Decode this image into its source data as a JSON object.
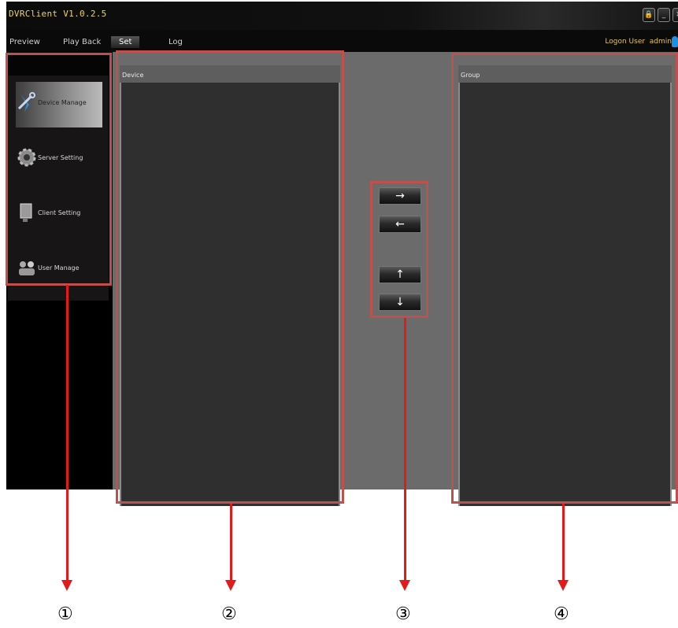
{
  "app": {
    "title": "DVRClient V1.0.2.5",
    "window_buttons": [
      "lock-icon",
      "minimize-icon",
      "close-icon"
    ],
    "logon_label": "Logon User",
    "user": "admin"
  },
  "menu": {
    "items": [
      "Preview",
      "Play Back",
      "Set",
      "Log"
    ],
    "active": "Set"
  },
  "sidebar": {
    "items": [
      {
        "label": "Device Manage",
        "icon": "wrench-icon",
        "active": true
      },
      {
        "label": "Server Setting",
        "icon": "gear-icon",
        "active": false
      },
      {
        "label": "Client Setting",
        "icon": "monitor-icon",
        "active": false
      },
      {
        "label": "User Manage",
        "icon": "users-icon",
        "active": false
      }
    ]
  },
  "panels": {
    "device_title": "Device",
    "group_title": "Group"
  },
  "transfer_buttons": [
    {
      "symbol": "→",
      "action": "move-right"
    },
    {
      "symbol": "←",
      "action": "move-left"
    },
    {
      "symbol": "↑",
      "action": "move-up"
    },
    {
      "symbol": "↓",
      "action": "move-down"
    }
  ],
  "annotations": {
    "markers": [
      "①",
      "②",
      "③",
      "④"
    ],
    "colors": {
      "box": "#c0504d",
      "arrow": "#e3191a"
    }
  }
}
